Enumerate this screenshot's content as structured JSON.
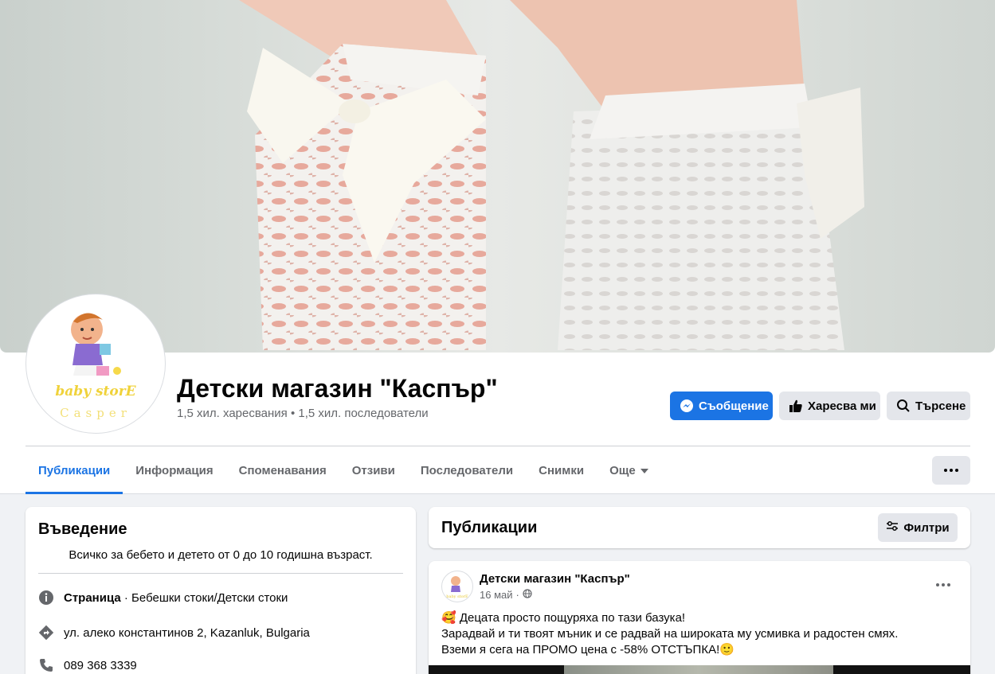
{
  "page": {
    "name": "Детски магазин \"Каспър\"",
    "stats": "1,5 хил. харесвания • 1,5 хил. последователи",
    "avatar_text_top": "baby storE",
    "avatar_text_bottom": "Casper"
  },
  "actions": {
    "message": "Съобщение",
    "like": "Харесва ми",
    "search": "Търсене"
  },
  "tabs": [
    {
      "label": "Публикации",
      "active": true
    },
    {
      "label": "Информация"
    },
    {
      "label": "Споменавания"
    },
    {
      "label": "Отзиви"
    },
    {
      "label": "Последователи"
    },
    {
      "label": "Снимки"
    },
    {
      "label": "Още"
    }
  ],
  "intro": {
    "title": "Въведение",
    "bio": "Всичко за бебето и детето от 0 до 10 годишна възраст.",
    "category_label": "Страница",
    "category_value": " · Бебешки стоки/Детски стоки",
    "address": "ул. алеко константинов 2, Kazanluk, Bulgaria",
    "phone": "089 368 3339"
  },
  "posts_section": {
    "title": "Публикации",
    "filters": "Филтри"
  },
  "post": {
    "author": "Детски магазин \"Каспър\"",
    "date": "16 май",
    "line1": "🥰 Децата просто пощуряха по тази базука!",
    "line2": "Зарадвай и ти твоят мъник и се радвай на широката му усмивка и радостен смях.",
    "line3": "Вземи я сега на ПРОМО цена с -58% ОТСТЪПКА!🙂"
  },
  "colors": {
    "accent": "#1b74e4",
    "background": "#f0f2f5",
    "secondary_text": "#65676b"
  }
}
